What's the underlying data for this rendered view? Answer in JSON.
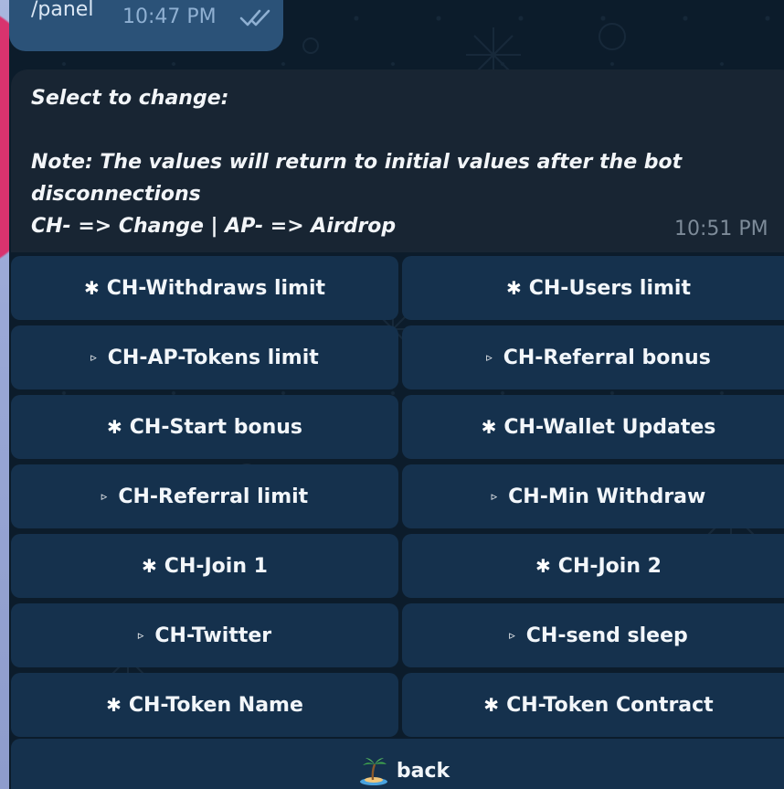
{
  "outgoing": {
    "text": "/panel",
    "time": "10:47 PM",
    "status_icon": "double-check-icon"
  },
  "incoming": {
    "lines": [
      "Select to change:",
      "",
      "Note: The values will return to initial values after the bot",
      "disconnections",
      "CH- => Change | AP- => Airdrop"
    ],
    "time": "10:51 PM"
  },
  "keyboard": {
    "rows": [
      [
        {
          "icon": "asterisk-icon",
          "glyph": "✱",
          "label": "CH-Withdraws limit"
        },
        {
          "icon": "asterisk-icon",
          "glyph": "✱",
          "label": "CH-Users limit"
        }
      ],
      [
        {
          "icon": "triangle-icon",
          "glyph": "▹",
          "label": "CH-AP-Tokens limit"
        },
        {
          "icon": "triangle-icon",
          "glyph": "▹",
          "label": "CH-Referral bonus"
        }
      ],
      [
        {
          "icon": "asterisk-icon",
          "glyph": "✱",
          "label": "CH-Start bonus"
        },
        {
          "icon": "asterisk-icon",
          "glyph": "✱",
          "label": "CH-Wallet Updates"
        }
      ],
      [
        {
          "icon": "triangle-icon",
          "glyph": "▹",
          "label": "CH-Referral limit"
        },
        {
          "icon": "triangle-icon",
          "glyph": "▹",
          "label": "CH-Min Withdraw"
        }
      ],
      [
        {
          "icon": "asterisk-icon",
          "glyph": "✱",
          "label": "CH-Join 1"
        },
        {
          "icon": "asterisk-icon",
          "glyph": "✱",
          "label": "CH-Join 2"
        }
      ],
      [
        {
          "icon": "triangle-icon",
          "glyph": "▹",
          "label": "CH-Twitter"
        },
        {
          "icon": "triangle-icon",
          "glyph": "▹",
          "label": "CH-send sleep"
        }
      ],
      [
        {
          "icon": "asterisk-icon",
          "glyph": "✱",
          "label": "CH-Token Name"
        },
        {
          "icon": "asterisk-icon",
          "glyph": "✱",
          "label": "CH-Token Contract"
        }
      ]
    ],
    "back": {
      "icon": "palm-island-icon",
      "label": "back"
    }
  },
  "colors": {
    "chat_bg": "#0c1c2b",
    "outgoing_bubble": "#2b5278",
    "incoming_bubble": "#182533",
    "keyboard_button": "#15314d",
    "accent_pink": "#d9336e"
  }
}
